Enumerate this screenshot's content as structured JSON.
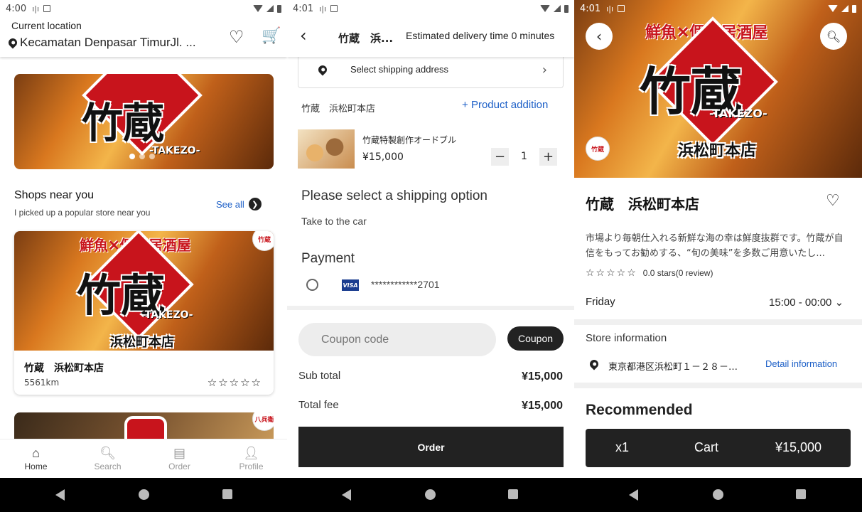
{
  "screen1": {
    "status": {
      "time": "4:00"
    },
    "header": {
      "current_location_label": "Current location",
      "location": "Kecamatan Denpasar TimurJl. ..."
    },
    "banner": {
      "main": "竹蔵",
      "sub": "-TAKEZO-"
    },
    "shops": {
      "title": "Shops near you",
      "subtitle": "I picked up a popular store near you",
      "see_all": "See all"
    },
    "card": {
      "banner": "鮮魚✕個室居酒屋",
      "main": "竹蔵",
      "sub": "-TAKEZO-",
      "branch": "浜松町本店",
      "name": "竹蔵　浜松町本店",
      "distance": "5561km",
      "stars": "☆☆☆☆☆"
    },
    "next_card_badge": "八兵衛",
    "nav": [
      {
        "label": "Home",
        "icon": "home-icon"
      },
      {
        "label": "Search",
        "icon": "search-icon"
      },
      {
        "label": "Order",
        "icon": "order-icon"
      },
      {
        "label": "Profile",
        "icon": "profile-icon"
      }
    ]
  },
  "screen2": {
    "status": {
      "time": "4:01"
    },
    "header": {
      "store": "竹蔵　浜...",
      "eta": "Estimated delivery time 0 minutes"
    },
    "shipping_address": "Select shipping address",
    "store_name": "竹蔵　浜松町本店",
    "product_addition": "Product addition",
    "item": {
      "name": "竹蔵特製創作オードブル",
      "price": "¥15,000",
      "qty": "1"
    },
    "shipping_option_title": "Please select a shipping option",
    "shipping_option": "Take to the car",
    "payment_title": "Payment",
    "card_brand": "VISA",
    "card_number": "************2701",
    "coupon_placeholder": "Coupon code",
    "coupon_button": "Coupon",
    "subtotal_label": "Sub total",
    "subtotal": "¥15,000",
    "total_label": "Total fee",
    "total": "¥15,000",
    "order_button": "Order"
  },
  "screen3": {
    "status": {
      "time": "4:01"
    },
    "hero": {
      "banner": "鮮魚✕個室居酒屋",
      "main": "竹蔵",
      "sub": "-TAKEZO-",
      "branch": "浜松町本店"
    },
    "title": "竹蔵　浜松町本店",
    "description": "市場より毎朝仕入れる新鮮な海の幸は鮮度抜群です。竹蔵が自信をもってお勧めする、“旬の美味”を多数ご用意いたし...",
    "stars": "☆☆☆☆☆",
    "rating_text": "0.0 stars(0 review)",
    "day": "Friday",
    "hours": "15:00 - 00:00",
    "store_info_title": "Store information",
    "address": "東京都港区浜松町１－２８－…",
    "detail_link": "Detail information",
    "recommended": "Recommended",
    "cart": {
      "qty": "x1",
      "label": "Cart",
      "total": "¥15,000"
    }
  }
}
